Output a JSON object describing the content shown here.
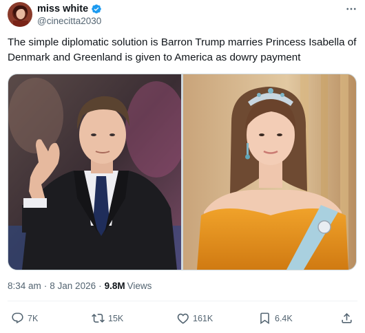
{
  "author": {
    "display_name": "miss white",
    "handle": "@cinecitta2030",
    "verified_icon": "verified-badge-icon",
    "verified_color": "#1d9bf0"
  },
  "tweet": {
    "text": "The simple diplomatic solution is Barron Trump marries Princess Isabella of Denmark and Greenland is given to America as dowry payment"
  },
  "meta": {
    "time": "8:34 am",
    "separator": "·",
    "date": "8 Jan 2026",
    "views_count": "9.8M",
    "views_label": "Views"
  },
  "actions": {
    "reply": {
      "icon": "reply-icon",
      "count": "7K"
    },
    "repost": {
      "icon": "repost-icon",
      "count": "15K"
    },
    "like": {
      "icon": "like-icon",
      "count": "161K"
    },
    "bookmark": {
      "icon": "bookmark-icon",
      "count": "6.4K"
    },
    "share": {
      "icon": "share-icon"
    }
  },
  "colors": {
    "text_primary": "#0f1419",
    "text_secondary": "#536471",
    "divider": "#eff3f4",
    "accent": "#1d9bf0"
  }
}
